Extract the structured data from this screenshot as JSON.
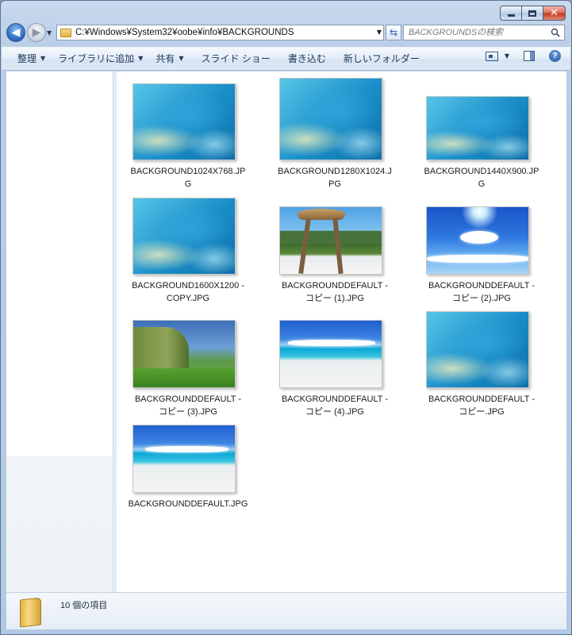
{
  "window": {
    "caption": {
      "minimize_glyph": "minimize-icon",
      "maximize_glyph": "maximize-icon",
      "close_glyph": "✕"
    }
  },
  "nav": {
    "back_glyph": "◀",
    "forward_glyph": "▶",
    "address": "C:¥Windows¥System32¥oobe¥info¥BACKGROUNDS",
    "search_placeholder": "BACKGROUNDSの検索"
  },
  "toolbar": {
    "organize": "整理",
    "add_to_library": "ライブラリに追加",
    "share": "共有",
    "slideshow": "スライド ショー",
    "burn": "書き込む",
    "new_folder": "新しいフォルダー",
    "help": "?"
  },
  "files": [
    {
      "name": "BACKGROUND1024X768.JP\nG",
      "art": "swirl"
    },
    {
      "name": "BACKGROUND1280X1024.J\nPG",
      "art": "swirl"
    },
    {
      "name": "BACKGROUND1440X900.JP\nG",
      "art": "swirl"
    },
    {
      "name": "BACKGROUND1600X1200 -\nCOPY.JPG",
      "art": "swirl"
    },
    {
      "name": "BACKGROUNDDEFAULT -\nコピー (1).JPG",
      "art": "hut"
    },
    {
      "name": "BACKGROUNDDEFAULT -\nコピー (2).JPG",
      "art": "sky"
    },
    {
      "name": "BACKGROUNDDEFAULT -\nコピー (3).JPG",
      "art": "cliff"
    },
    {
      "name": "BACKGROUNDDEFAULT -\nコピー (4).JPG",
      "art": "beach"
    },
    {
      "name": "BACKGROUNDDEFAULT -\nコピー.JPG",
      "art": "swirl"
    },
    {
      "name": "BACKGROUNDDEFAULT.JPG",
      "art": "beach"
    }
  ],
  "status": {
    "item_count": "10 個の項目"
  }
}
